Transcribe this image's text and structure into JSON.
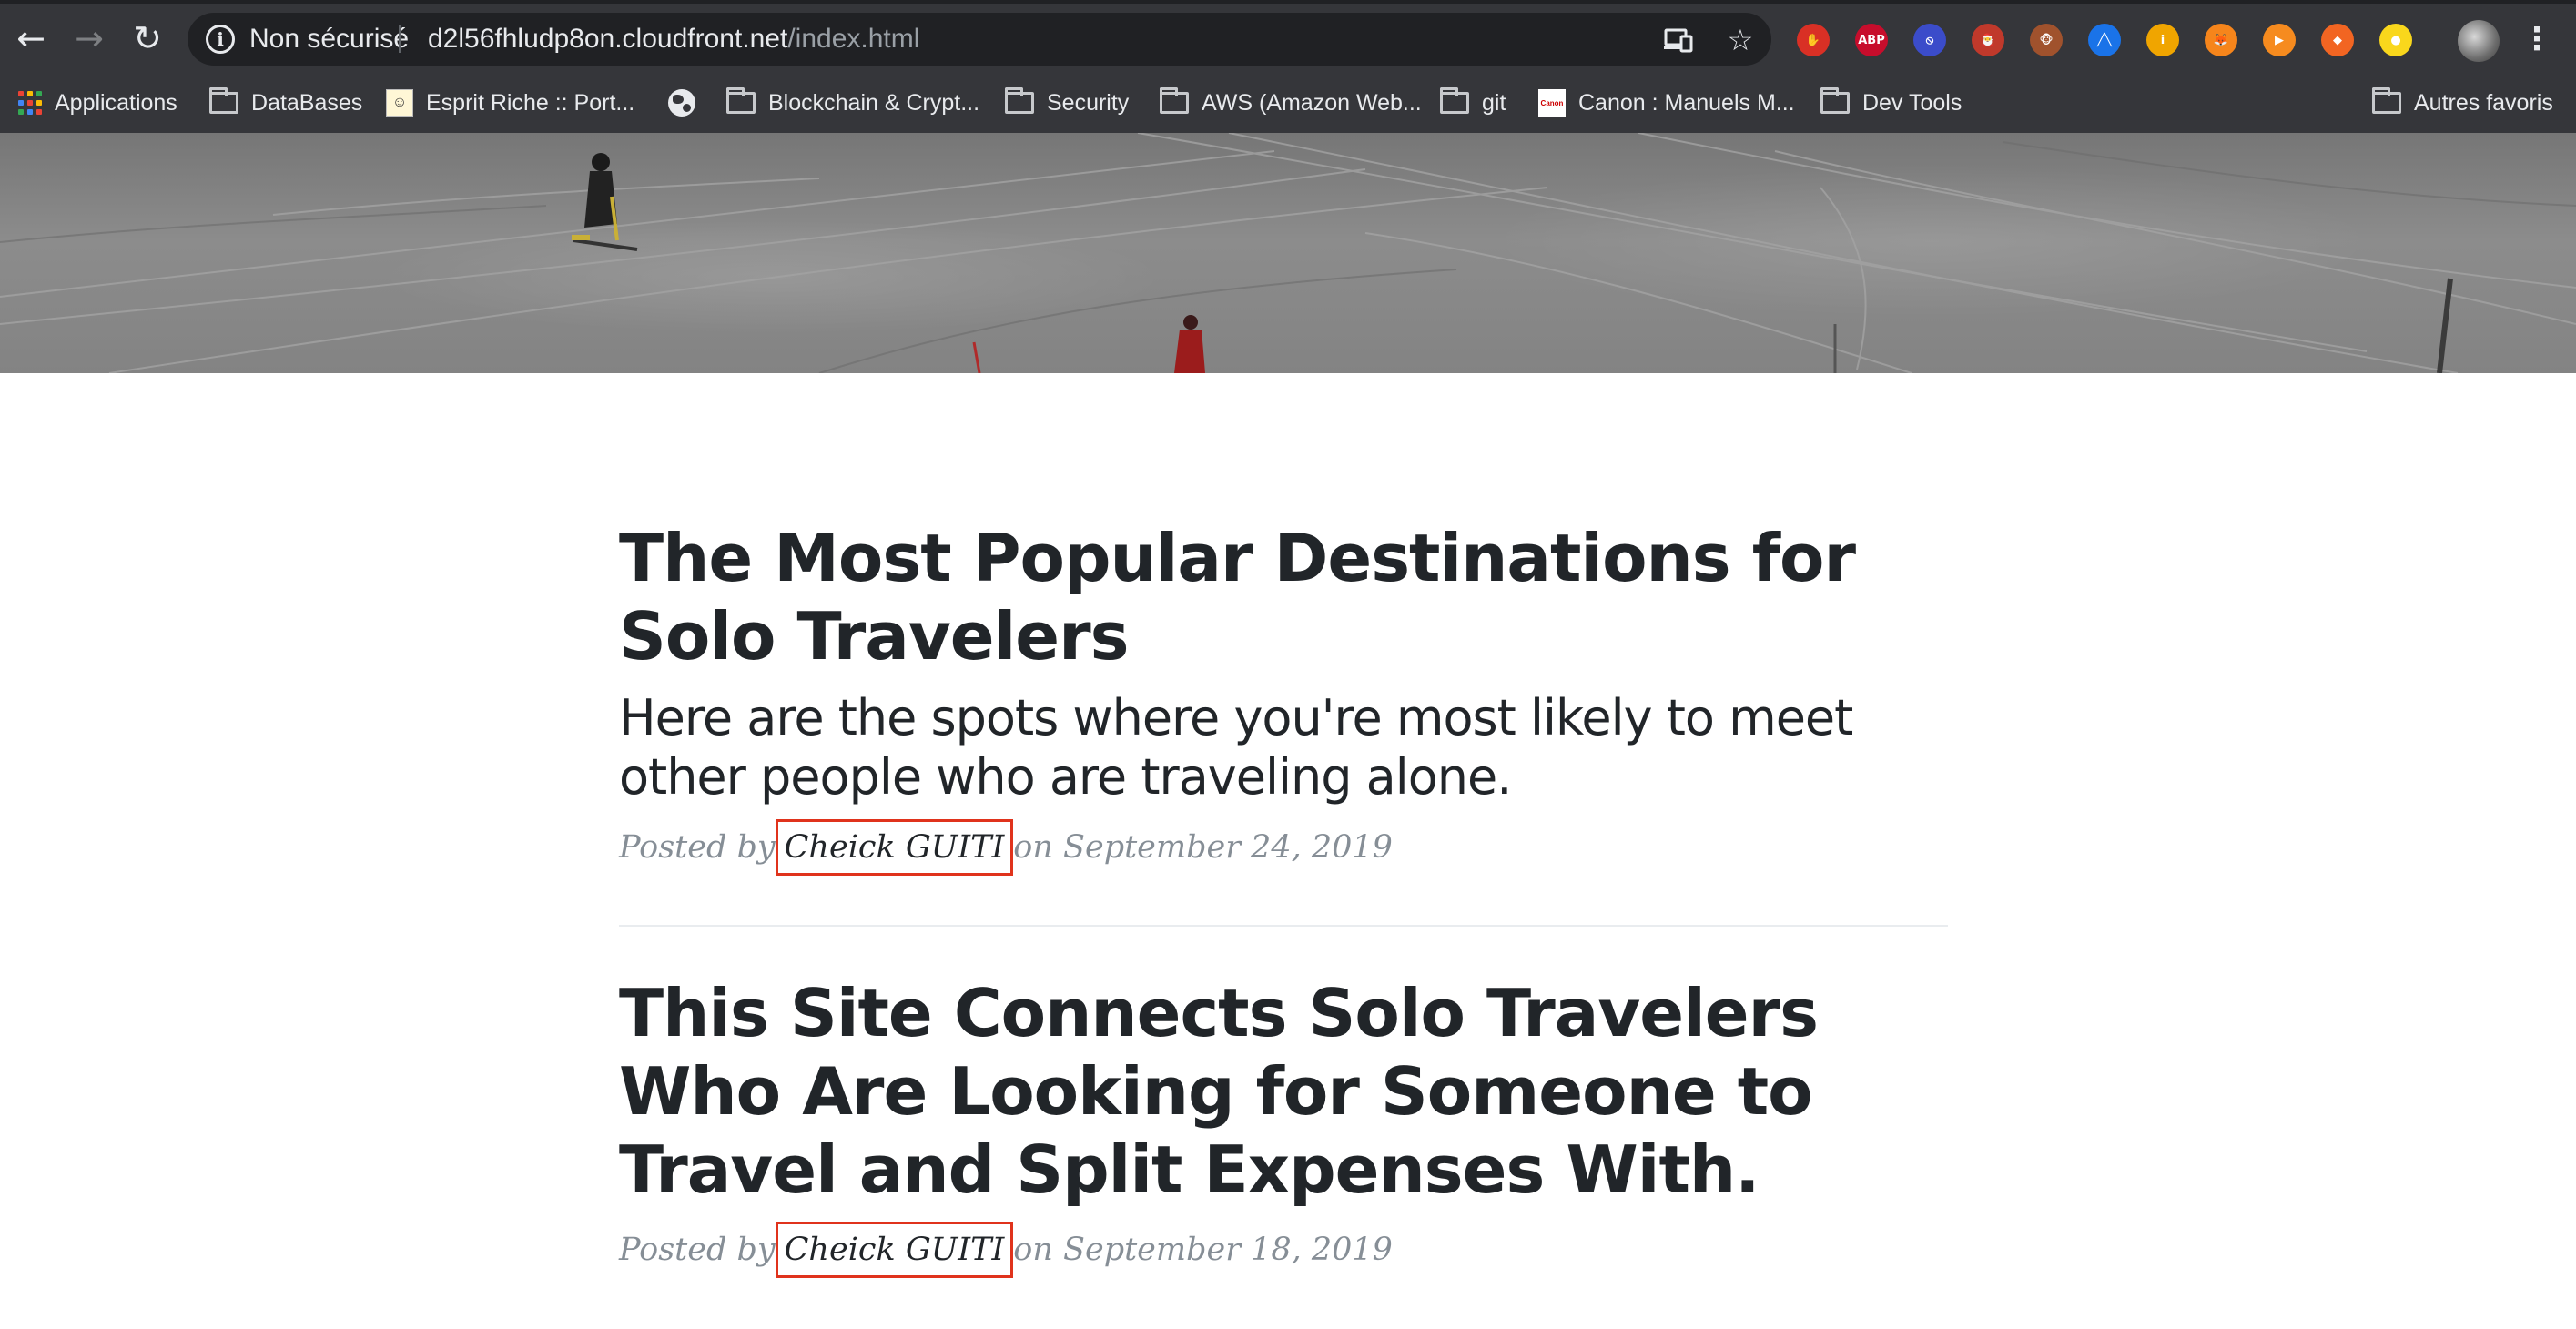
{
  "browser": {
    "nav": {
      "back_icon": "arrow-left-icon",
      "forward_icon": "arrow-right-icon",
      "reload_icon": "reload-icon"
    },
    "omnibox": {
      "security_label": "Non sécurisé",
      "url_host": "d2l56fhludp8on.cloudfront.net",
      "url_path": "/index.html"
    },
    "extensions": [
      {
        "name": "stop-extension-icon",
        "color": "#d93025",
        "text": "✋"
      },
      {
        "name": "adblock-plus-extension-icon",
        "color": "#c70d2c",
        "text": "ABP"
      },
      {
        "name": "blocker-extension-icon",
        "color": "#3b4cca",
        "text": "⦸"
      },
      {
        "name": "santa-extension-icon",
        "color": "#c0392b",
        "text": "🎅"
      },
      {
        "name": "monkey-extension-icon",
        "color": "#a0522d",
        "text": "🐵"
      },
      {
        "name": "chart-extension-icon",
        "color": "#1a73e8",
        "text": "╱╲"
      },
      {
        "name": "person-extension-icon",
        "color": "#f0a500",
        "text": "i"
      },
      {
        "name": "metamask-extension-icon",
        "color": "#f6851b",
        "text": "🦊"
      },
      {
        "name": "play-extension-icon",
        "color": "#f68b1f",
        "text": "▶"
      },
      {
        "name": "diamond-extension-icon",
        "color": "#f26522",
        "text": "◆"
      },
      {
        "name": "ghost-extension-icon",
        "color": "#f9d71c",
        "text": "●"
      }
    ],
    "bookmarks": [
      {
        "name": "bookmark-applications",
        "icon": "apps-grid-icon",
        "label": "Applications"
      },
      {
        "name": "bookmark-databases",
        "icon": "folder-icon",
        "label": "DataBases"
      },
      {
        "name": "bookmark-esprit-riche",
        "icon": "site-favicon-icon",
        "label": "Esprit Riche :: Port..."
      },
      {
        "name": "bookmark-globe",
        "icon": "globe-icon",
        "label": ""
      },
      {
        "name": "bookmark-blockchain",
        "icon": "folder-icon",
        "label": "Blockchain & Crypt..."
      },
      {
        "name": "bookmark-security",
        "icon": "folder-icon",
        "label": "Security"
      },
      {
        "name": "bookmark-aws",
        "icon": "folder-icon",
        "label": "AWS (Amazon Web..."
      },
      {
        "name": "bookmark-git",
        "icon": "folder-icon",
        "label": "git"
      },
      {
        "name": "bookmark-canon",
        "icon": "canon-favicon-icon",
        "label": "Canon : Manuels M..."
      },
      {
        "name": "bookmark-dev-tools",
        "icon": "folder-icon",
        "label": "Dev Tools"
      },
      {
        "name": "bookmark-other",
        "icon": "folder-icon",
        "label": "Autres favoris"
      }
    ]
  },
  "page": {
    "posts": [
      {
        "title": "The Most Popular Destinations for Solo Travelers",
        "subtitle": "Here are the spots where you're most likely to meet other people who are traveling alone.",
        "meta_prefix": "Posted by",
        "author": "Cheick GUITI",
        "meta_suffix": "on September 24, 2019"
      },
      {
        "title": "This Site Connects Solo Travelers Who Are Looking for Someone to Travel and Split Expenses With.",
        "meta_prefix": "Posted by",
        "author": "Cheick GUITI",
        "meta_suffix": "on September 18, 2019"
      }
    ]
  },
  "colors": {
    "chrome_bg": "#35363a",
    "omnibox_bg": "#202124",
    "heading_text": "#212529",
    "meta_text": "#868e96",
    "author_highlight": "#e0331c"
  }
}
